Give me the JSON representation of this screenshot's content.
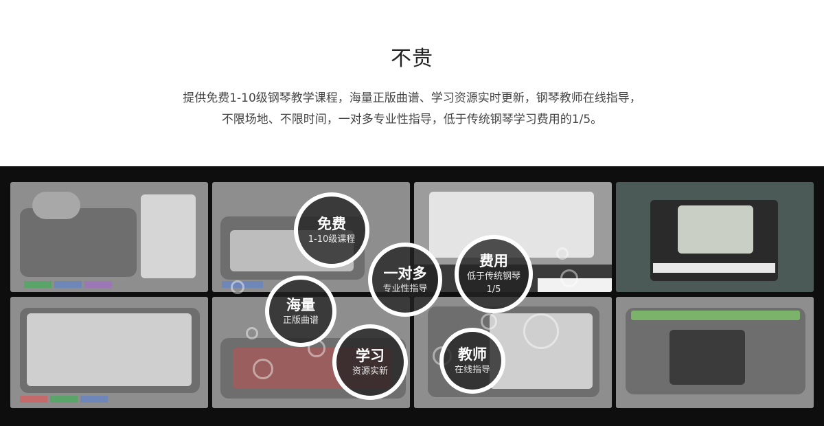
{
  "header": {
    "title": "不贵",
    "desc_line1": "提供免费1-10级钢琴教学课程，海量正版曲谱、学习资源实时更新，钢琴教师在线指导，",
    "desc_line2": "不限场地、不限时间，一对多专业性指导，低于传统钢琴学习费用的1/5。"
  },
  "bubbles": {
    "free": {
      "title": "免费",
      "line1": "1-10级课程"
    },
    "massive": {
      "title": "海量",
      "line1": "正版曲谱"
    },
    "one_to_many": {
      "title": "一对多",
      "line1": "专业性指导"
    },
    "cost": {
      "title": "费用",
      "line1": "低于传统钢琴",
      "line2": "1/5"
    },
    "learn": {
      "title": "学习",
      "line1": "资源实新"
    },
    "teacher": {
      "title": "教师",
      "line1": "在线指导"
    }
  },
  "colors": {
    "band_bg": "#0e0e0e",
    "bubble_border": "#ffffff",
    "strip_green": "#3aa64a",
    "strip_blue": "#2b7dd6",
    "strip_yellow": "#e7c02c",
    "strip_purple": "#8a4bc8",
    "strip_red": "#d23b3b"
  }
}
